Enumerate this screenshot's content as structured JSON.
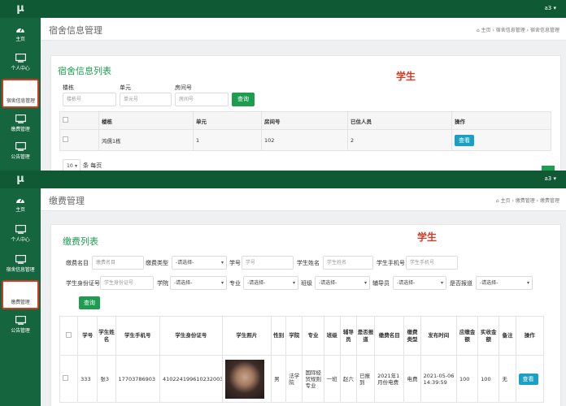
{
  "top": {
    "logo": "μ",
    "user": "a3 ▾",
    "nav": [
      {
        "label": "主页",
        "icon": "dashboard-icon"
      },
      {
        "label": "个人中心",
        "icon": "monitor-icon"
      },
      {
        "label": "宿舍信息管理",
        "icon": "monitor-icon"
      },
      {
        "label": "缴费管理",
        "icon": "monitor-icon"
      },
      {
        "label": "公告管理",
        "icon": "monitor-icon"
      }
    ],
    "page_title": "宿舍信息管理",
    "breadcrumb": "⌂ 主页  ›  宿舍信息管理  ›  宿舍信息管理",
    "panel_title": "宿舍信息列表",
    "annotation": "学生",
    "filters": {
      "building_label": "楼栋",
      "building_ph": "楼栋号",
      "unit_label": "单元",
      "unit_ph": "单元号",
      "room_label": "房间号",
      "room_ph": "房间号",
      "search": "查询"
    },
    "table": {
      "headers": [
        "",
        "楼栋",
        "单元",
        "房间号",
        "已住人员",
        "操作"
      ],
      "rows": [
        [
          "",
          "鸿儒1栋",
          "1",
          "102",
          "2",
          "查看"
        ]
      ]
    },
    "page_size": "10",
    "per_page_text": "条 每页"
  },
  "bottom": {
    "logo": "μ",
    "user": "a3 ▾",
    "nav": [
      {
        "label": "主页",
        "icon": "dashboard-icon"
      },
      {
        "label": "个人中心",
        "icon": "monitor-icon"
      },
      {
        "label": "宿舍信息管理",
        "icon": "monitor-icon"
      },
      {
        "label": "缴费管理",
        "icon": "monitor-icon"
      },
      {
        "label": "公告管理",
        "icon": "monitor-icon"
      }
    ],
    "page_title": "缴费管理",
    "breadcrumb": "⌂ 主页  ›  缴费管理  ›  缴费管理",
    "panel_title": "缴费列表",
    "annotation": "学生",
    "filters": {
      "fee_name_label": "缴费名目",
      "fee_name_ph": "缴费名目",
      "fee_type_label": "缴费类型",
      "fee_type_val": "-请选择-",
      "student_no_label": "学号",
      "student_no_ph": "学号",
      "student_name_label": "学生姓名",
      "student_name_ph": "学生姓名",
      "phone_label": "学生手机号",
      "phone_ph": "学生手机号",
      "idcard_label": "学生身份证号",
      "idcard_ph": "学生身份证号",
      "college_label": "学院",
      "college_val": "-请选择-",
      "major_label": "专业",
      "major_val": "-请选择-",
      "class_label": "班级",
      "class_val": "-请选择-",
      "counselor_label": "辅导员",
      "counselor_val": "-请选择-",
      "reported_label": "是否报道",
      "reported_val": "-请选择-",
      "search": "查询"
    },
    "table": {
      "headers": [
        "",
        "学号",
        "学生姓名",
        "学生手机号",
        "学生身份证号",
        "学生照片",
        "性别",
        "学院",
        "专业",
        "班级",
        "辅导员",
        "是否报道",
        "缴费名目",
        "缴费类型",
        "发布时间",
        "应缴金额",
        "实收金额",
        "备注",
        "操作"
      ],
      "row": {
        "no": "333",
        "name": "张3",
        "phone": "17703786903",
        "idcard": "410224199610232003",
        "gender": "男",
        "college": "法学院",
        "major": "国际经贸规则专业",
        "class": "一班",
        "counselor": "赵六",
        "reported": "已报到",
        "fee_name": "2021年1月份电费",
        "fee_type": "电费",
        "time": "2021-05-06 14:39:59",
        "due": "100",
        "paid": "100",
        "note": "无",
        "action": "查看"
      }
    }
  }
}
